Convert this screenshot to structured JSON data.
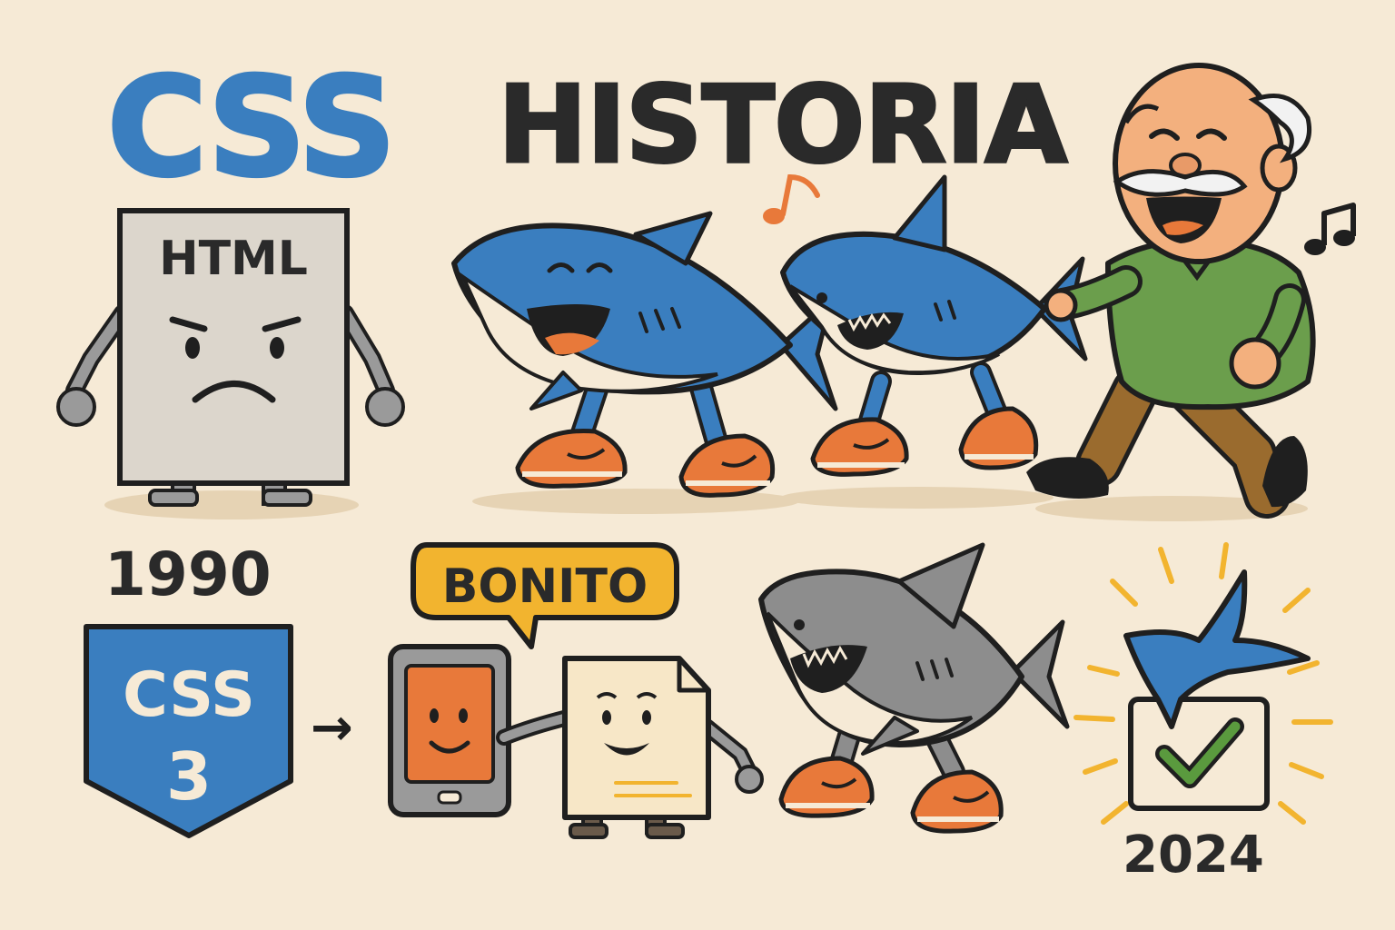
{
  "title": {
    "css": "CSS",
    "historia": "HISTORIA"
  },
  "html_page": {
    "label": "HTML"
  },
  "timeline": {
    "year_start": "1990",
    "year_end": "2024",
    "arrow": "→"
  },
  "badge": {
    "line1": "CSS",
    "line2": "3"
  },
  "speech_bubble": {
    "text": "BONITO"
  },
  "colors": {
    "background": "#f6ead6",
    "accent_blue": "#3a7ebf",
    "outline": "#1f1f1f",
    "sneaker_orange": "#e8793a",
    "bubble_yellow": "#f2b42f",
    "shirt_green": "#6b9e4c",
    "check_green": "#5a9a3e"
  }
}
